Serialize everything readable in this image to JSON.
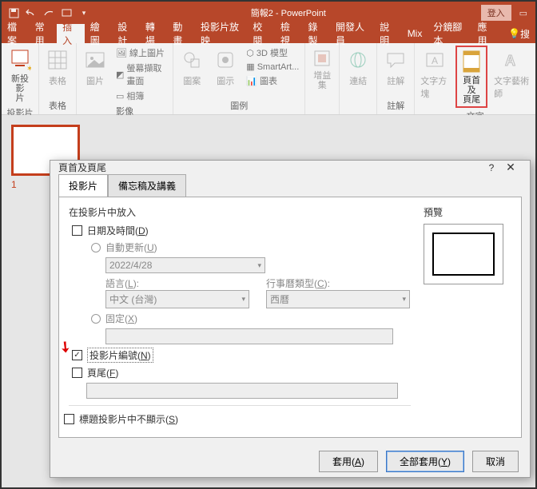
{
  "titlebar": {
    "title": "簡報2 - PowerPoint",
    "login": "登入"
  },
  "menu": {
    "items": [
      "檔案",
      "常用",
      "插入",
      "繪圖",
      "設計",
      "轉場",
      "動畫",
      "投影片放映",
      "校閱",
      "檢視",
      "錄製",
      "開發人員",
      "說明",
      "Mix",
      "分鏡腳本",
      "應用"
    ],
    "active_index": 2,
    "tell_me": "搜"
  },
  "ribbon": {
    "groups": {
      "slides": {
        "new_slide": "新投影\n片",
        "label": "投影片"
      },
      "tables": {
        "table": "表格",
        "label": "表格"
      },
      "images": {
        "picture": "圖片",
        "online_pic": "線上圖片",
        "screenshot": "螢幕擷取畫面",
        "album": "相簿",
        "label": "影像"
      },
      "illust": {
        "shapes": "圖案",
        "icons": "圖示",
        "model3d": "3D 模型",
        "smartart": "SmartArt...",
        "chart": "圖表",
        "label": "圖例"
      },
      "addins": {
        "addins": "增益\n集",
        "label": ""
      },
      "links": {
        "link": "連結",
        "label": ""
      },
      "comments": {
        "comment": "註解",
        "label": "註解"
      },
      "text": {
        "textbox": "文字方塊",
        "header_footer": "頁首及\n頁尾",
        "wordart": "文字藝術師",
        "label": "文字"
      }
    }
  },
  "slide_panel": {
    "num": "1"
  },
  "dialog": {
    "title": "頁首及頁尾",
    "tabs": [
      "投影片",
      "備忘稿及講義"
    ],
    "include_label": "在投影片中放入",
    "datetime": "日期及時間(D)",
    "auto_update": "自動更新(U)",
    "date_value": "2022/4/28",
    "lang_label": "語言(L):",
    "lang_value": "中文 (台灣)",
    "cal_label": "行事曆類型(C):",
    "cal_value": "西曆",
    "fixed": "固定(X)",
    "slide_num": "投影片編號(N)",
    "footer": "頁尾(F)",
    "hide_title": "標題投影片中不顯示(S)",
    "preview_label": "預覽",
    "btn_apply": "套用(A)",
    "btn_apply_all": "全部套用(Y)",
    "btn_cancel": "取消"
  }
}
